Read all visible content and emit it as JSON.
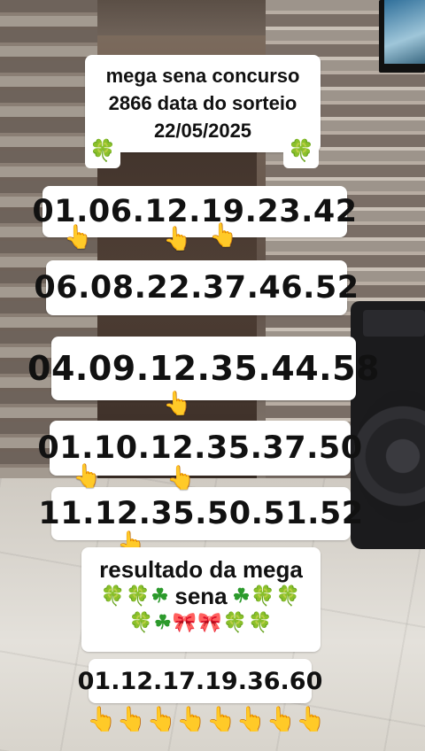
{
  "header": {
    "line1": "mega sena concurso",
    "line2": "2866 data do sorteio",
    "line3": "22/05/2025",
    "clover_icon": "🍀"
  },
  "games": [
    {
      "numbers": "01.06.12.19.23.42"
    },
    {
      "numbers": "06.08.22.37.46.52"
    },
    {
      "numbers": "04.09.12.35.44.58"
    },
    {
      "numbers": "01.10.12.35.37.50"
    },
    {
      "numbers": "11.12.35.50.51.52"
    }
  ],
  "result": {
    "line1": "resultado da mega",
    "line2": "sena",
    "clovers_left": "🍀🍀☘",
    "clovers_right": "☘🍀🍀",
    "clovers_bottom": "🍀☘🎀🎀🍀🍀",
    "numbers": "01.12.17.19.36.60"
  },
  "pointer_icon": "👆",
  "colors": {
    "label_bg": "#ffffff",
    "text": "#111111",
    "clover": "#2c9a2c",
    "hand": "#f4b400"
  }
}
